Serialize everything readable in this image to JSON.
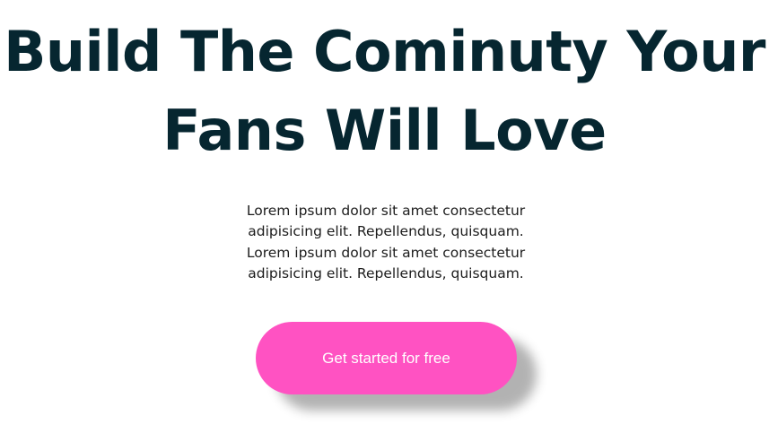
{
  "hero": {
    "headline": {
      "line1": "Build The Cominuty Your",
      "line2": "Fans Will Love"
    },
    "description": {
      "line1": "Lorem ipsum dolor sit amet consectetur",
      "line2": "adipisicing elit. Repellendus, quisquam.",
      "line3": "Lorem ipsum dolor sit amet consectetur",
      "line4": "adipisicing elit. Repellendus, quisquam."
    },
    "cta": {
      "label": "Get started for free"
    }
  },
  "colors": {
    "heading": "#062630",
    "body_text": "#1c1c1c",
    "cta_background": "#ff52c2",
    "cta_text": "#ffffff",
    "page_background": "#ffffff"
  }
}
